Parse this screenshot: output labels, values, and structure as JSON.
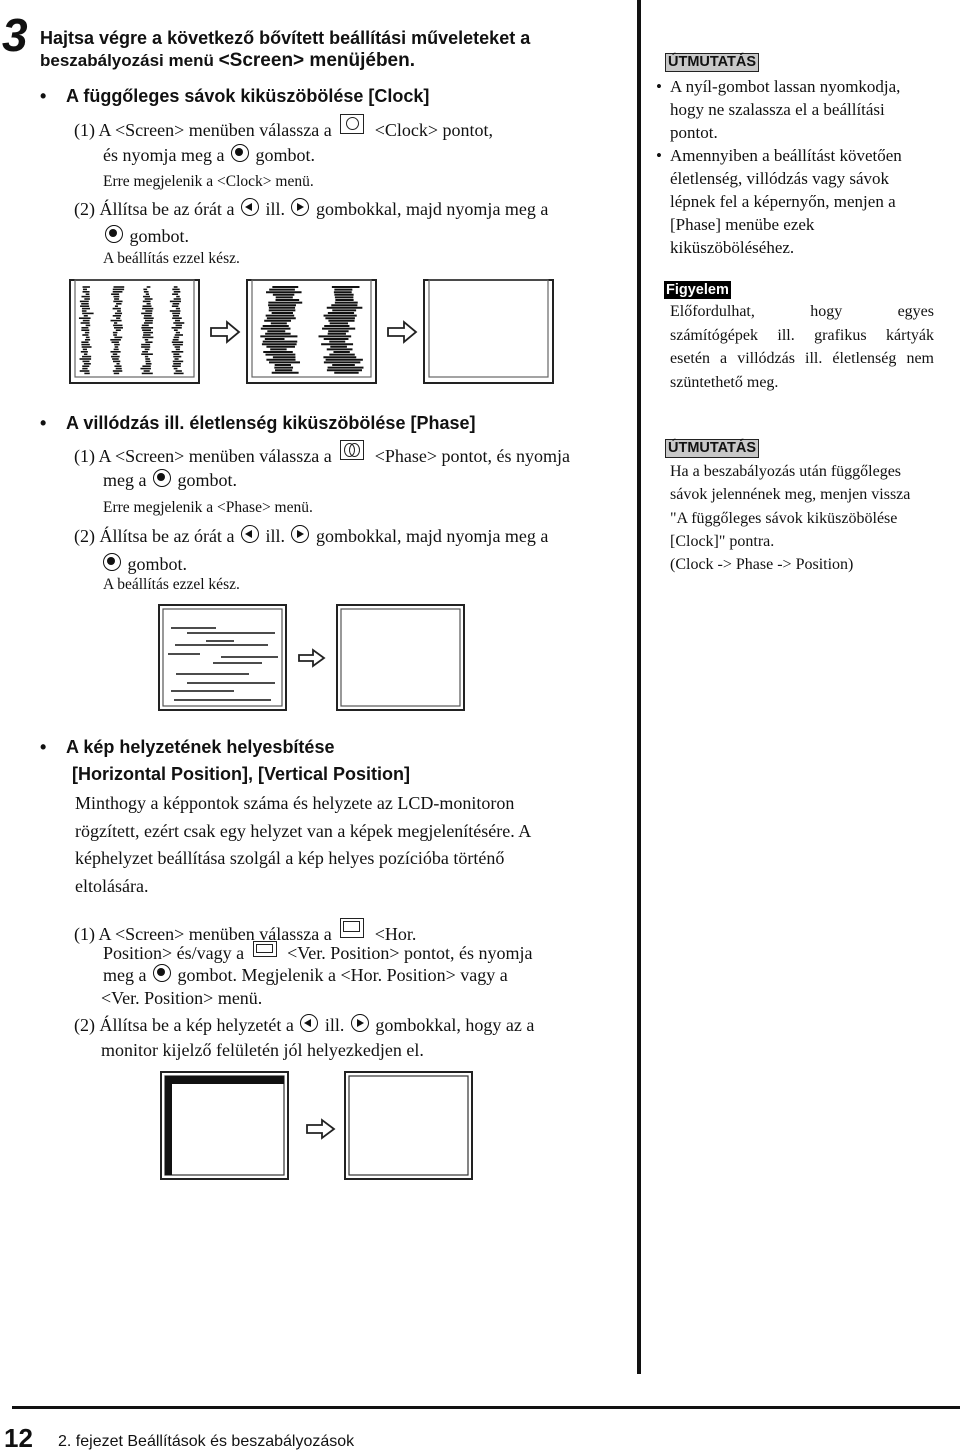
{
  "step": {
    "number": "3",
    "title_line1": "Hajtsa végre a következő bővített beállítási műveleteket a",
    "title_line2_prefix": "beszabályozási menü ",
    "title_line2_suffix": "<Screen> menüjében."
  },
  "clock_section": {
    "bullet": "•",
    "heading": "A függőleges sávok kiküszöbölése [Clock]",
    "step1_prefix": "(1) A <Screen> menüben válassza a",
    "step1_suffix": "<Clock> pontot,",
    "step1_line2_prefix": "és nyomja meg a",
    "step1_line2_suffix": "gombot.",
    "step1_note": "Erre megjelenik a <Clock> menü.",
    "step2_prefix": "(2) Állítsa be az órát a",
    "step2_mid": "ill.",
    "step2_suffix": "gombokkal, majd nyomja meg a",
    "step2_line2": "gombot.",
    "done": "A beállítás ezzel kész.",
    "icons": [
      "clock-menu-icon",
      "enter-button-icon",
      "left-button-icon",
      "right-button-icon"
    ]
  },
  "phase_section": {
    "bullet": "•",
    "heading": "A villódzás ill. életlenség kiküszöbölése [Phase]",
    "step1_prefix": "(1) A <Screen> menüben válassza a",
    "step1_suffix": "<Phase> pontot, és nyomja",
    "step1_line2_prefix": "meg a",
    "step1_line2_suffix": "gombot.",
    "step1_note": "Erre megjelenik a <Phase> menü.",
    "step2_prefix": "(2) Állítsa be az órát a",
    "step2_mid": "ill.",
    "step2_suffix": "gombokkal, majd nyomja meg a",
    "step2_line2": "gombot.",
    "done": "A beállítás ezzel kész."
  },
  "position_section": {
    "bullet": "•",
    "heading_line1": "A kép helyzetének helyesbítése",
    "heading_line2": "[Horizontal Position], [Vertical Position]",
    "paragraph": [
      "Minthogy a képpontok száma és helyzete az LCD-monitoron",
      "rögzített, ezért csak egy helyzet van a képek megjelenítésére. A",
      "képhelyzet beállítása szolgál a kép helyes pozícióba történő",
      "eltolására."
    ],
    "step1_l1_prefix": "(1) A <Screen> menüben válassza a",
    "step1_l1_suffix": "<Hor.",
    "step1_l2_prefix": "Position> és/vagy a",
    "step1_l2_suffix": "<Ver. Position> pontot, és nyomja",
    "step1_l3_prefix": "meg a",
    "step1_l3_suffix": "gombot. Megjelenik a <Hor. Position> vagy a",
    "step1_l4": "<Ver. Position> menü.",
    "step2_l1_prefix": "(2) Állítsa be a kép helyzetét a",
    "step2_l1_mid": "ill.",
    "step2_l1_suffix": "gombokkal, hogy az a",
    "step2_l2": "monitor kijelző felületén jól helyezkedjen el."
  },
  "sidebar": {
    "tip1": {
      "label": "ÚTMUTATÁS",
      "bullets": [
        [
          "A nyíl-gombot lassan nyomkodja,",
          "hogy ne szalassza el a beállítási",
          "pontot."
        ],
        [
          "Amennyiben a beállítást követően",
          "életlenség, villódzás vagy sávok",
          "lépnek fel a képernyőn, menjen a",
          "[Phase] menübe ezek",
          "kiküszöböléséhez."
        ]
      ]
    },
    "warning": {
      "label": "Figyelem",
      "lines": [
        "Előfordulhat, hogy egyes",
        "számítógépek ill. grafikus kártyák",
        "esetén a villódzás ill. életlenség nem",
        "szüntethető meg."
      ]
    },
    "tip2": {
      "label": "ÚTMUTATÁS",
      "lines": [
        "Ha a beszabályozás után függőleges",
        "sávok jelennének meg, menjen vissza",
        "\"A függőleges sávok kiküszöbölése",
        "[Clock]\" pontra.",
        "(Clock -> Phase -> Position)"
      ]
    }
  },
  "footer": {
    "page_number": "12",
    "chapter": "2. fejezet Beállítások és beszabályozások"
  },
  "illustrations": {
    "clock": [
      "vertical-bands-screen",
      "arrow",
      "wavy-bands-screen",
      "arrow",
      "clean-screen"
    ],
    "phase": [
      "flicker-lines-screen",
      "arrow",
      "clean-screen"
    ],
    "position": [
      "offset-image-screen",
      "arrow",
      "clean-screen"
    ]
  }
}
